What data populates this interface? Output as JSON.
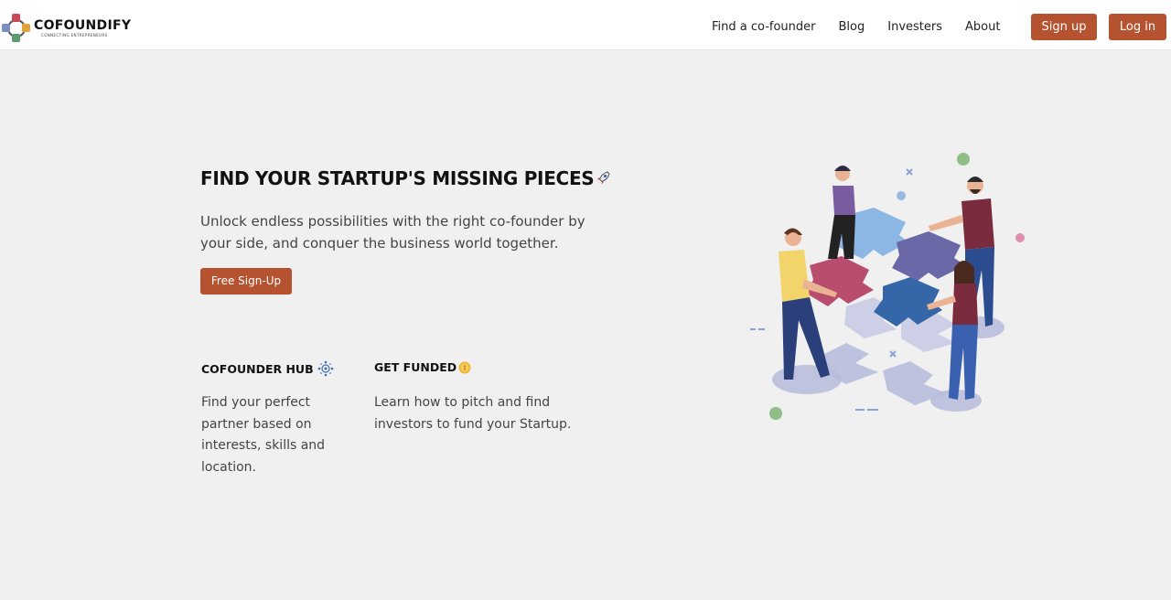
{
  "brand": {
    "name": "COFOUNDIFY",
    "tagline": "CONNECTING ENTREPRENEURS"
  },
  "nav": {
    "links": [
      "Find a co-founder",
      "Blog",
      "Investers",
      "About"
    ],
    "signup_label": "Sign up",
    "login_label": "Log in"
  },
  "hero": {
    "title": "FIND YOUR STARTUP'S MISSING PIECES",
    "subtitle": "Unlock endless possibilities with the right co-founder by your side, and conquer the business world together.",
    "cta_label": "Free Sign-Up"
  },
  "features": [
    {
      "title": "COFOUNDER HUB",
      "icon": "network-icon",
      "text": "Find your perfect partner based on interests, skills and location."
    },
    {
      "title": "GET FUNDED",
      "icon": "coin-icon",
      "text": "Learn how to pitch and find investors to fund your Startup."
    }
  ],
  "colors": {
    "accent": "#b5522f",
    "background": "#f0f0f0",
    "navbar": "#ffffff"
  },
  "illustration": {
    "icon": "people-assembling-puzzle-illustration"
  }
}
